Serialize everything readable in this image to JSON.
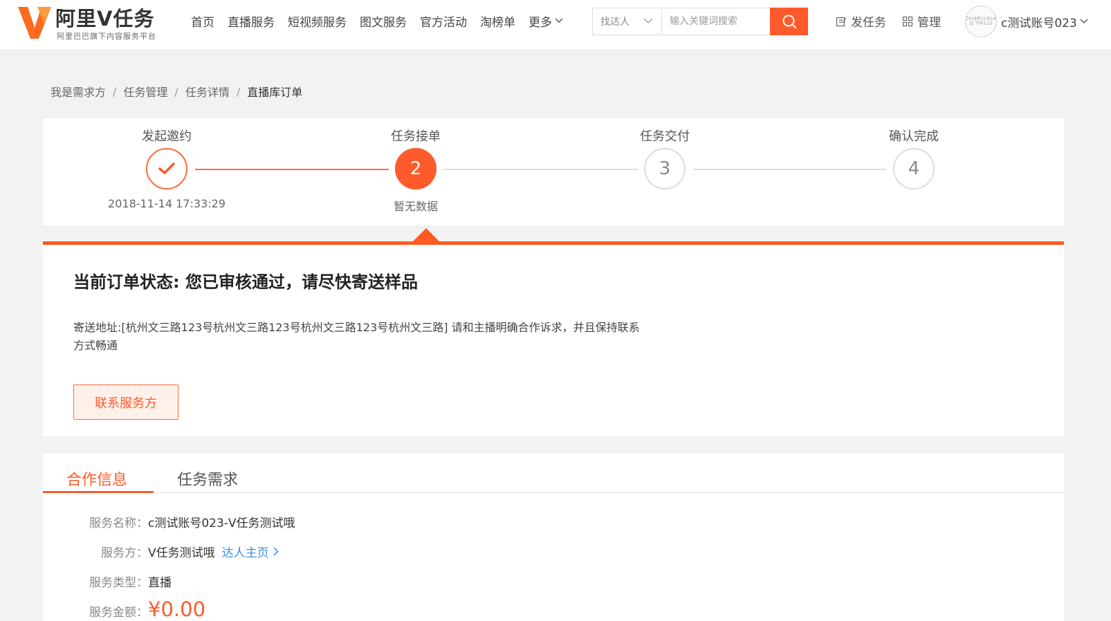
{
  "header": {
    "logo_title": "阿里V任务",
    "logo_subtitle": "阿里巴巴旗下内容服务平台",
    "nav": [
      "首页",
      "直播服务",
      "短视频服务",
      "图文服务",
      "官方活动",
      "淘榜单"
    ],
    "nav_more": "更多",
    "search_type": "找达人",
    "search_placeholder": "输入关键词搜索",
    "publish_task": "发任务",
    "manage": "管理",
    "username": "c测试账号023",
    "avatar_text": "2018年11月14日 下午5:33"
  },
  "breadcrumb": [
    "我是需求方",
    "任务管理",
    "任务详情",
    "直播库订单"
  ],
  "steps": [
    {
      "title": "发起邀约",
      "state": "done",
      "symbol": "",
      "sub": "2018-11-14 17:33:29"
    },
    {
      "title": "任务接单",
      "state": "active",
      "symbol": "2",
      "sub": "暂无数据"
    },
    {
      "title": "任务交付",
      "state": "pending",
      "symbol": "3",
      "sub": ""
    },
    {
      "title": "确认完成",
      "state": "pending",
      "symbol": "4",
      "sub": ""
    }
  ],
  "status": {
    "title": "当前订单状态: 您已审核通过，请尽快寄送样品",
    "description": "寄送地址:[杭州文三路123号杭州文三路123号杭州文三路123号杭州文三路] 请和主播明确合作诉求，并且保持联系方式畅通",
    "contact_button": "联系服务方"
  },
  "info": {
    "tabs": [
      "合作信息",
      "任务需求"
    ],
    "service_name_label": "服务名称：",
    "service_name": "c测试账号023-V任务测试哦",
    "provider_label": "服务方：",
    "provider": "V任务测试哦",
    "provider_link": "达人主页",
    "service_type_label": "服务类型：",
    "service_type": "直播",
    "amount_label": "服务金额：",
    "amount": "¥0.00"
  },
  "colors": {
    "accent": "#ff5a2b",
    "link": "#3a8ee6"
  }
}
